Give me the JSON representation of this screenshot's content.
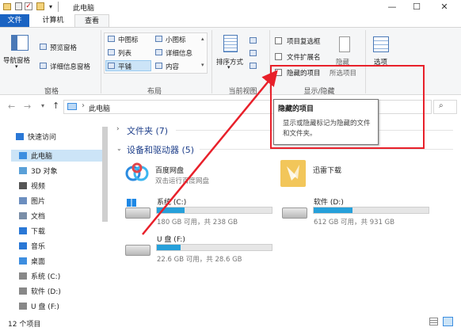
{
  "window": {
    "title": "此电脑",
    "minimize": "—",
    "maximize": "☐",
    "close": "✕"
  },
  "tabs": [
    "文件",
    "计算机",
    "查看"
  ],
  "ribbon": {
    "panes": {
      "nav_pane": "导航窗格",
      "preview_pane": "预览窗格",
      "details_pane": "详细信息窗格",
      "group": "窗格"
    },
    "layout": {
      "medium_icons": "中图标",
      "small_icons": "小图标",
      "list": "列表",
      "details": "详细信息",
      "tiles": "平铺",
      "content": "内容",
      "group": "布局"
    },
    "current_view": {
      "sort_by": "排序方式",
      "group": "当前视图"
    },
    "show_hide": {
      "item_checkboxes": "项目复选框",
      "file_extensions": "文件扩展名",
      "hidden_items": "隐藏的项目",
      "hide": "隐藏",
      "selected_items": "所选项目",
      "group": "显示/隐藏"
    },
    "options": "选项"
  },
  "address": {
    "path": "此电脑",
    "separator": "›"
  },
  "tooltip": {
    "title": "隐藏的项目",
    "body": "显示或隐藏标记为隐藏的文件和文件夹。"
  },
  "nav": {
    "items": [
      {
        "label": "快速访问",
        "icon": "star-icon",
        "color": "#2a78d6"
      },
      {
        "label": "此电脑",
        "icon": "computer-icon",
        "color": "#3d8ee0"
      },
      {
        "label": "3D 对象",
        "icon": "cube-icon",
        "color": "#5aa0d8"
      },
      {
        "label": "视频",
        "icon": "video-icon",
        "color": "#555555"
      },
      {
        "label": "图片",
        "icon": "picture-icon",
        "color": "#6c8ebf"
      },
      {
        "label": "文档",
        "icon": "document-icon",
        "color": "#7a8ea8"
      },
      {
        "label": "下载",
        "icon": "download-icon",
        "color": "#2a78d6"
      },
      {
        "label": "音乐",
        "icon": "music-icon",
        "color": "#2a78d6"
      },
      {
        "label": "桌面",
        "icon": "desktop-icon",
        "color": "#3d8ee0"
      },
      {
        "label": "系统 (C:)",
        "icon": "drive-icon",
        "color": "#888888"
      },
      {
        "label": "软件 (D:)",
        "icon": "drive-icon",
        "color": "#888888"
      },
      {
        "label": "U 盘 (F:)",
        "icon": "usb-drive-icon",
        "color": "#888888"
      }
    ]
  },
  "content": {
    "folders_header": "文件夹 (7)",
    "devices_header": "设备和驱动器 (5)",
    "apps": [
      {
        "name": "百度网盘",
        "sub": "双击运行百度网盘"
      },
      {
        "name": "迅雷下载",
        "sub": ""
      }
    ],
    "drives": [
      {
        "name": "系统 (C:)",
        "usage": "180 GB 可用，共 238 GB",
        "used_fraction": 0.24
      },
      {
        "name": "软件 (D:)",
        "usage": "612 GB 可用，共 931 GB",
        "used_fraction": 0.34
      },
      {
        "name": "U 盘 (F:)",
        "usage": "22.6 GB 可用，共 28.6 GB",
        "used_fraction": 0.21
      }
    ]
  },
  "status": {
    "count": "12 个项目"
  },
  "colors": {
    "accent": "#1a63c2",
    "annotation": "#e8202a",
    "drive_fill": "#26a0da"
  }
}
